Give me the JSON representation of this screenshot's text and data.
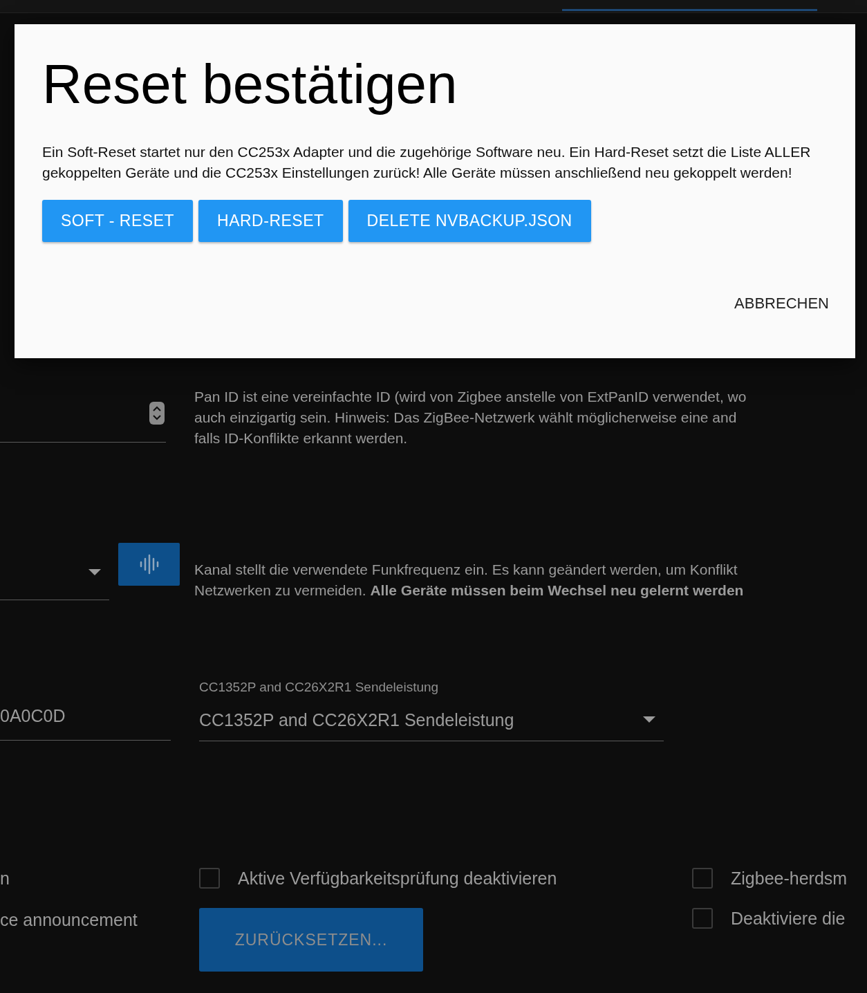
{
  "dialog": {
    "title": "Reset bestätigen",
    "message": "Ein Soft-Reset startet nur den CC253x Adapter und die zugehörige Software neu. Ein Hard-Reset setzt die Liste ALLER gekoppelten Geräte und die CC253x Einstellungen zurück! Alle Geräte müssen anschließend neu gekoppelt werden!",
    "buttons": [
      "SOFT - RESET",
      "HARD-RESET",
      "DELETE NVBACKUP.JSON"
    ],
    "cancel": "ABBRECHEN"
  },
  "pan_id": {
    "description_lines": [
      "Pan ID ist eine vereinfachte ID (wird von Zigbee anstelle von ExtPanID verwendet, wo",
      "auch einzigartig sein. Hinweis: Das ZigBee-Netzwerk wählt möglicherweise eine and",
      "falls ID-Konflikte erkannt werden."
    ]
  },
  "channel": {
    "description_lines": [
      "Kanal stellt die verwendete Funkfrequenz ein. Es kann geändert werden, um Konflikt",
      "Netzwerken zu vermeiden. **Alle Geräte müssen beim Wechsel neu gelernt werden**"
    ]
  },
  "power": {
    "left_value": "0A0C0D",
    "label": "CC1352P and CC26X2R1 Sendeleistung",
    "value": "CC1352P and CC26X2R1 Sendeleistung"
  },
  "options": {
    "left_labels": [
      "n",
      "ce announcement"
    ],
    "checkboxes": [
      {
        "label": "Aktive Verfügbarkeitsprüfung deaktivieren",
        "checked": false
      },
      {
        "label": "Zigbee-herdsm",
        "checked": false
      },
      {
        "label": "Deaktiviere die",
        "checked": false
      }
    ],
    "reset_button": "ZURÜCKSETZEN..."
  }
}
